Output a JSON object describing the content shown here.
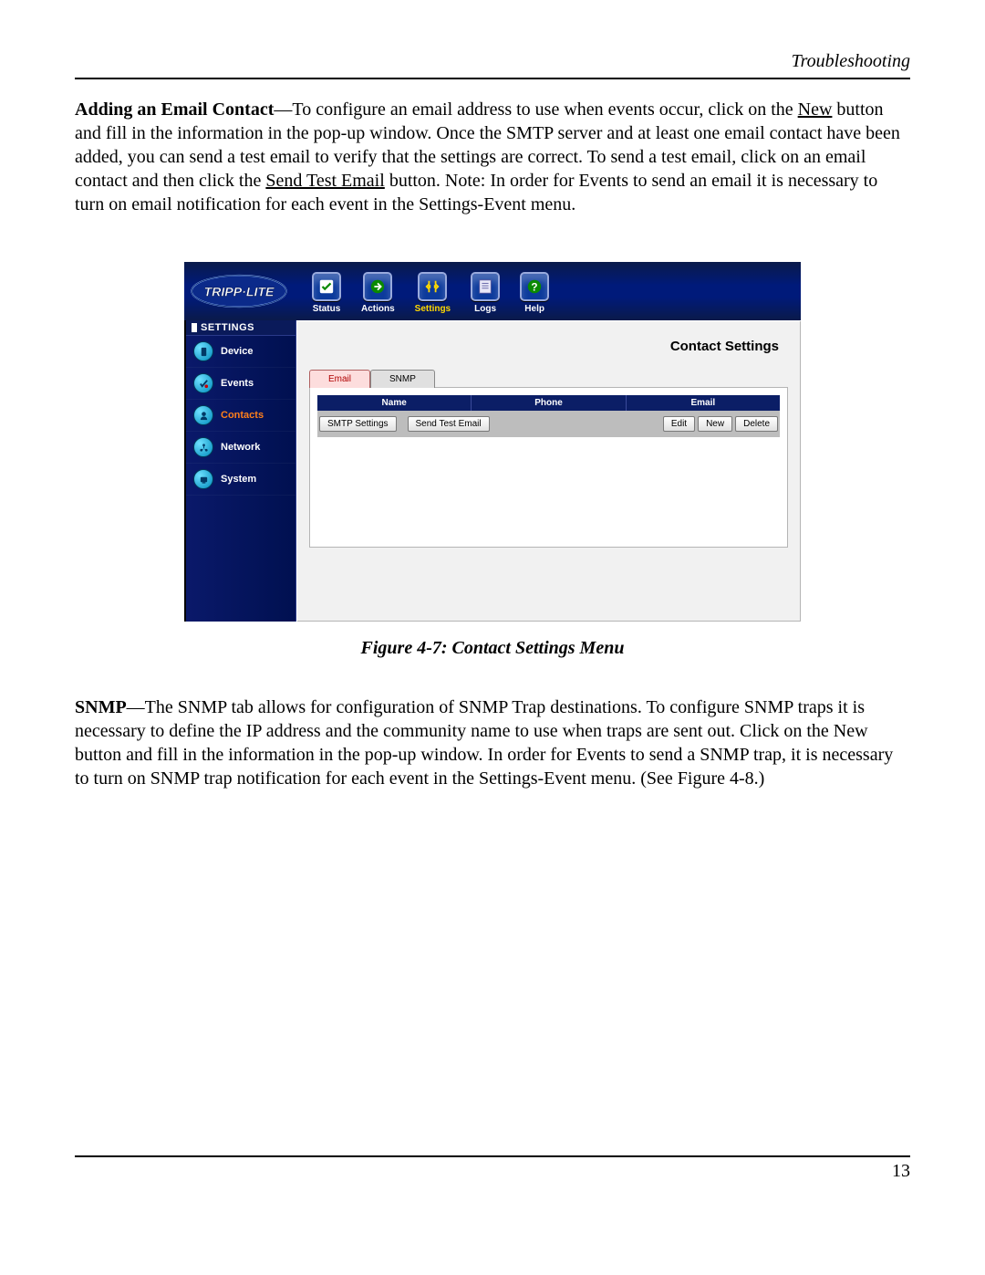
{
  "section_header": "Troubleshooting",
  "para1": {
    "title": "Adding an Email Contact",
    "dash": "—",
    "t1": "To configure an email address to use when events occur, click on the ",
    "u1": "New",
    "t2": " button and fill in the information in the pop-up window. Once the SMTP server and at least one email contact have been added, you can send a test email to verify that the settings are correct. To send a test email, click on an email contact and then click the ",
    "u2": "Send Test Email",
    "t3": " button. Note: In order for Events to send an email it is necessary to turn on email notification for each event in the Settings-Event menu."
  },
  "figure_caption": "Figure 4-7: Contact Settings Menu",
  "para2": {
    "title": "SNMP",
    "dash": "—",
    "body": "The SNMP tab allows for configuration of SNMP Trap destinations. To configure SNMP traps it is necessary to define the IP address and the community name to use when traps are sent out. Click on the New button and fill in the information in the pop-up window.  In order for Events to send a SNMP trap, it is necessary to turn on SNMP trap notification for each event in the Settings-Event menu. (See Figure 4-8.)"
  },
  "page_number": "13",
  "app": {
    "logo_text": "TRIPP·LITE",
    "nav": [
      {
        "label": "Status"
      },
      {
        "label": "Actions"
      },
      {
        "label": "Settings"
      },
      {
        "label": "Logs"
      },
      {
        "label": "Help"
      }
    ],
    "sidebar_heading": "SETTINGS",
    "sidebar": [
      {
        "label": "Device"
      },
      {
        "label": "Events"
      },
      {
        "label": "Contacts"
      },
      {
        "label": "Network"
      },
      {
        "label": "System"
      }
    ],
    "content_title": "Contact Settings",
    "tabs": {
      "email": "Email",
      "snmp": "SNMP"
    },
    "columns": {
      "name": "Name",
      "phone": "Phone",
      "email": "Email"
    },
    "buttons": {
      "smtp": "SMTP Settings",
      "sendtest": "Send Test Email",
      "edit": "Edit",
      "new": "New",
      "delete": "Delete"
    }
  }
}
